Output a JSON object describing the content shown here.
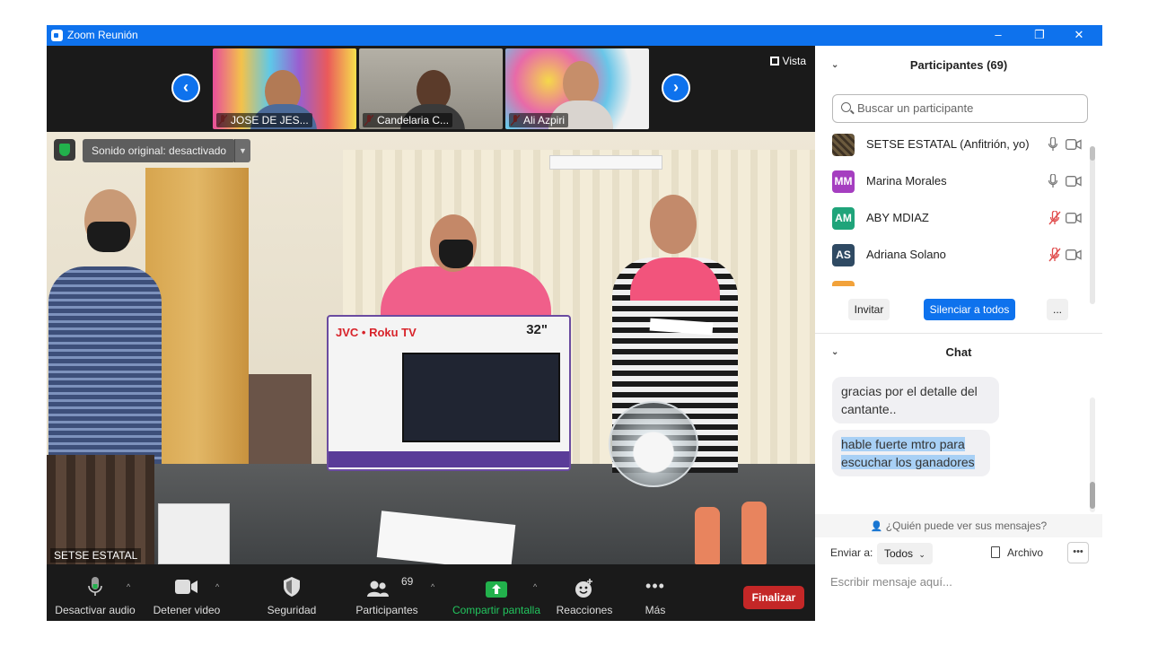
{
  "window": {
    "title": "Zoom Reunión",
    "controls": [
      "–",
      "❐",
      "✕"
    ]
  },
  "gallery": {
    "tiles": [
      {
        "name": "JOSE DE JES..."
      },
      {
        "name": "Candelaria C..."
      },
      {
        "name": "Ali Azpiri"
      }
    ],
    "view_label": "Vista"
  },
  "video": {
    "sound_label": "Sonido original: desactivado",
    "speaker_name": "SETSE ESTATAL"
  },
  "toolbar": {
    "audio": "Desactivar audio",
    "video": "Detener video",
    "security": "Seguridad",
    "participants": "Participantes",
    "participants_count": "69",
    "share": "Compartir pantalla",
    "reactions": "Reacciones",
    "more": "Más",
    "end": "Finalizar"
  },
  "participants_panel": {
    "title": "Participantes (69)",
    "search_placeholder": "Buscar un participante",
    "list": [
      {
        "initials": "",
        "name": "SETSE ESTATAL (Anfitrión, yo)",
        "mic": "on",
        "color": "#6b5a3e"
      },
      {
        "initials": "MM",
        "name": "Marina Morales",
        "mic": "on",
        "color": "#a53ec0"
      },
      {
        "initials": "AM",
        "name": "ABY MDIAZ",
        "mic": "off",
        "color": "#1fa47a"
      },
      {
        "initials": "AS",
        "name": "Adriana Solano",
        "mic": "off",
        "color": "#2f4a63"
      }
    ],
    "invite": "Invitar",
    "mute_all": "Silenciar a todos",
    "more": "..."
  },
  "chat_panel": {
    "title": "Chat",
    "messages": [
      {
        "line1": "gracias por el detalle del",
        "line2": "cantante.."
      },
      {
        "line1": "hable fuerte mtro para",
        "line2": "escuchar los ganadores"
      }
    ],
    "who_can_see": "¿Quién puede ver sus mensajes?",
    "send_to_label": "Enviar a:",
    "send_to_value": "Todos",
    "file_label": "Archivo",
    "input_placeholder": "Escribir mensaje aquí..."
  },
  "colors": {
    "accent": "#0e72ed",
    "end": "#c42727",
    "share": "#22b14c",
    "muted": "#e04b4b"
  }
}
